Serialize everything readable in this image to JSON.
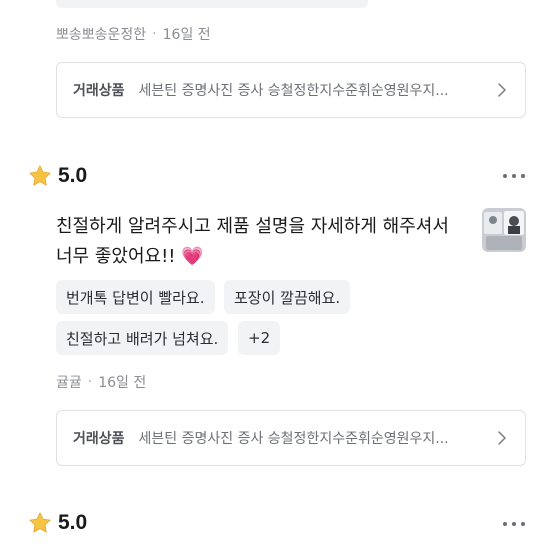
{
  "review_prev": {
    "author": "뽀송뽀송운정한",
    "time": "16일 전",
    "product": {
      "label": "거래상품",
      "title": "세븐틴 증명사진 증사 승철정한지수준휘순영원우지..."
    }
  },
  "review_main": {
    "rating": "5.0",
    "text": "친절하게 알려주시고 제품 설명을 자세하게 해주셔서 너무 좋았어요!!",
    "emoji": "💗",
    "tags": [
      "번개톡 답변이 빨라요.",
      "포장이 깔끔해요.",
      "친절하고 배려가 넘쳐요."
    ],
    "more_tags": "+2",
    "author": "귤귤",
    "time": "16일 전",
    "product": {
      "label": "거래상품",
      "title": "세븐틴 증명사진 증사 승철정한지수준휘순영원우지..."
    }
  },
  "review_next": {
    "rating": "5.0"
  },
  "icons": {
    "star": "star-icon",
    "chevron": "chevron-right-icon",
    "more": "more-dots-icon"
  },
  "colors": {
    "star": "#f6c343",
    "tag_bg": "#f2f3f5",
    "meta_text": "#8a8d93"
  }
}
